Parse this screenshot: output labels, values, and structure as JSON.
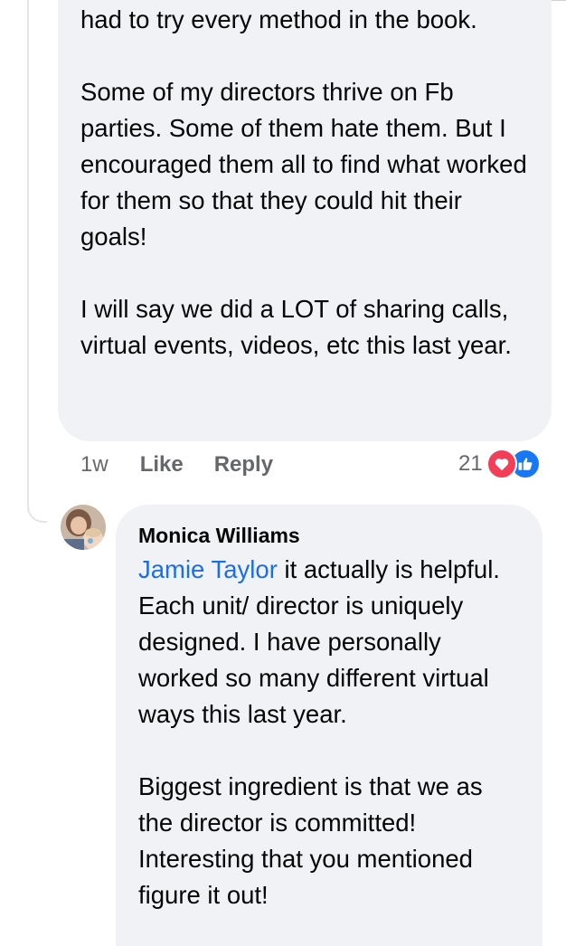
{
  "comment_1": {
    "text": "had to try every method in the book.\n\nSome of my directors thrive on Fb parties. Some of them hate them. But I encouraged them all to find what worked for them so that they could hit their goals!\n\nI will say we did a LOT of sharing calls, virtual events, videos, etc this last year.",
    "timestamp": "1w",
    "like_label": "Like",
    "reply_label": "Reply",
    "reaction_count": "21",
    "reaction_icons": [
      "love-icon",
      "like-thumb-icon"
    ]
  },
  "comment_2": {
    "author": "Monica Williams",
    "mention": "Jamie Taylor",
    "text": " it actually is helpful. Each unit/ director is uniquely designed. I have personally worked so many different virtual ways this last year.\n\nBiggest ingredient is that we as the director is committed! Interesting that you mentioned figure it out!"
  },
  "colors": {
    "bubble": "#f0f2f5",
    "meta_text": "#65676b",
    "mention": "#1b6ee8",
    "love": "#f33e58",
    "like": "#1877f2"
  }
}
